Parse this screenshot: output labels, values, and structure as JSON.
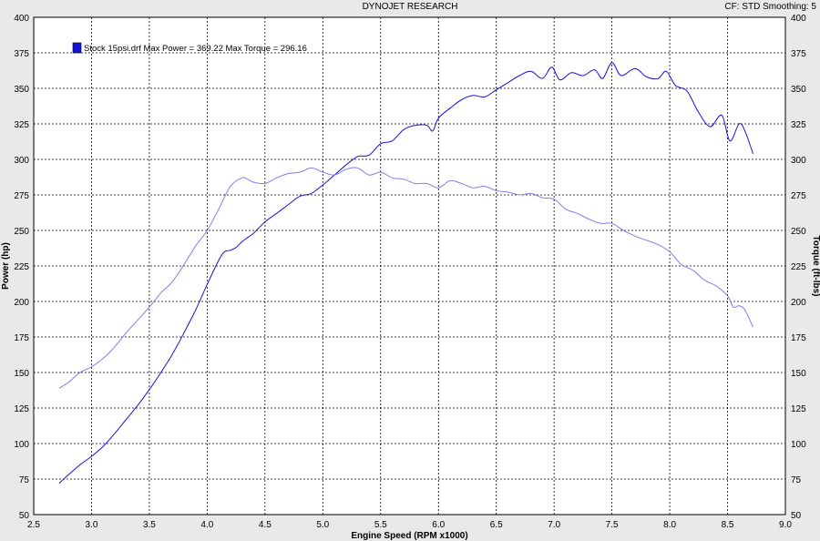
{
  "header": {
    "title": "DYNOJET RESEARCH",
    "right": "CF: STD  Smoothing: 5"
  },
  "legend": {
    "label": "Stock 15psi.drf Max Power = 369.22 Max Torque = 296.16"
  },
  "colors": {
    "plot_bg": "#ffffff",
    "page_bg": "#e9e9e9",
    "power": "#1515d8",
    "torque": "#7f7ff0",
    "grid": "#000000"
  },
  "chart_data": {
    "type": "line",
    "xlabel": "Engine Speed (RPM x1000)",
    "ylabel": "Power (hp)",
    "y2label": "Torque (ft-lbs)",
    "xlim": [
      2.5,
      9.0
    ],
    "ylim": [
      50,
      400
    ],
    "y2lim": [
      50,
      400
    ],
    "xticks": [
      "2.5",
      "3.0",
      "3.5",
      "4.0",
      "4.5",
      "5.0",
      "5.5",
      "6.0",
      "6.5",
      "7.0",
      "7.5",
      "8.0",
      "8.5",
      "9.0"
    ],
    "yticks": [
      "50",
      "75",
      "100",
      "125",
      "150",
      "175",
      "200",
      "225",
      "250",
      "275",
      "300",
      "325",
      "350",
      "375",
      "400"
    ],
    "grid": true,
    "series": [
      {
        "name": "Power",
        "x": [
          2.72,
          2.8,
          2.9,
          3.0,
          3.1,
          3.2,
          3.3,
          3.4,
          3.5,
          3.6,
          3.7,
          3.8,
          3.9,
          4.0,
          4.1,
          4.15,
          4.2,
          4.25,
          4.3,
          4.35,
          4.4,
          4.5,
          4.6,
          4.7,
          4.8,
          4.9,
          5.0,
          5.1,
          5.2,
          5.3,
          5.4,
          5.5,
          5.6,
          5.7,
          5.8,
          5.9,
          5.95,
          6.0,
          6.1,
          6.2,
          6.3,
          6.4,
          6.5,
          6.6,
          6.7,
          6.8,
          6.9,
          6.98,
          7.05,
          7.15,
          7.25,
          7.35,
          7.42,
          7.5,
          7.58,
          7.7,
          7.8,
          7.9,
          7.97,
          8.05,
          8.15,
          8.25,
          8.35,
          8.45,
          8.52,
          8.6,
          8.65,
          8.72
        ],
        "y": [
          72,
          78,
          85,
          91,
          98,
          107,
          117,
          127,
          138,
          150,
          163,
          178,
          194,
          212,
          229,
          235,
          236,
          238,
          242,
          245,
          248,
          256,
          262,
          268,
          274,
          276,
          282,
          289,
          296,
          302,
          303,
          311,
          313,
          321,
          324,
          324,
          320,
          329,
          336,
          342,
          345,
          344,
          349,
          354,
          359,
          362,
          357,
          365,
          356,
          361,
          359,
          363,
          357,
          368,
          359,
          364,
          358,
          357,
          362,
          352,
          348,
          333,
          323,
          331,
          313,
          325,
          320,
          304
        ]
      },
      {
        "name": "Torque",
        "x": [
          2.72,
          2.8,
          2.9,
          3.0,
          3.1,
          3.2,
          3.3,
          3.4,
          3.5,
          3.6,
          3.7,
          3.8,
          3.9,
          4.0,
          4.1,
          4.2,
          4.3,
          4.35,
          4.4,
          4.5,
          4.6,
          4.7,
          4.8,
          4.9,
          5.0,
          5.1,
          5.2,
          5.3,
          5.4,
          5.5,
          5.6,
          5.7,
          5.8,
          5.9,
          6.0,
          6.1,
          6.2,
          6.3,
          6.4,
          6.5,
          6.6,
          6.7,
          6.8,
          6.9,
          7.0,
          7.1,
          7.2,
          7.3,
          7.4,
          7.5,
          7.6,
          7.7,
          7.8,
          7.9,
          8.0,
          8.1,
          8.2,
          8.3,
          8.4,
          8.5,
          8.55,
          8.6,
          8.65,
          8.72
        ],
        "y": [
          139,
          143,
          150,
          154,
          160,
          168,
          178,
          187,
          196,
          206,
          214,
          226,
          239,
          250,
          265,
          281,
          287,
          286,
          284,
          283,
          287,
          290,
          291,
          294,
          291,
          289,
          293,
          294,
          289,
          291,
          287,
          286,
          283,
          283,
          280,
          285,
          283,
          280,
          281,
          278,
          277,
          275,
          276,
          273,
          272,
          265,
          262,
          258,
          255,
          255,
          250,
          246,
          243,
          240,
          235,
          226,
          222,
          215,
          211,
          204,
          196,
          197,
          194,
          182
        ]
      }
    ]
  }
}
